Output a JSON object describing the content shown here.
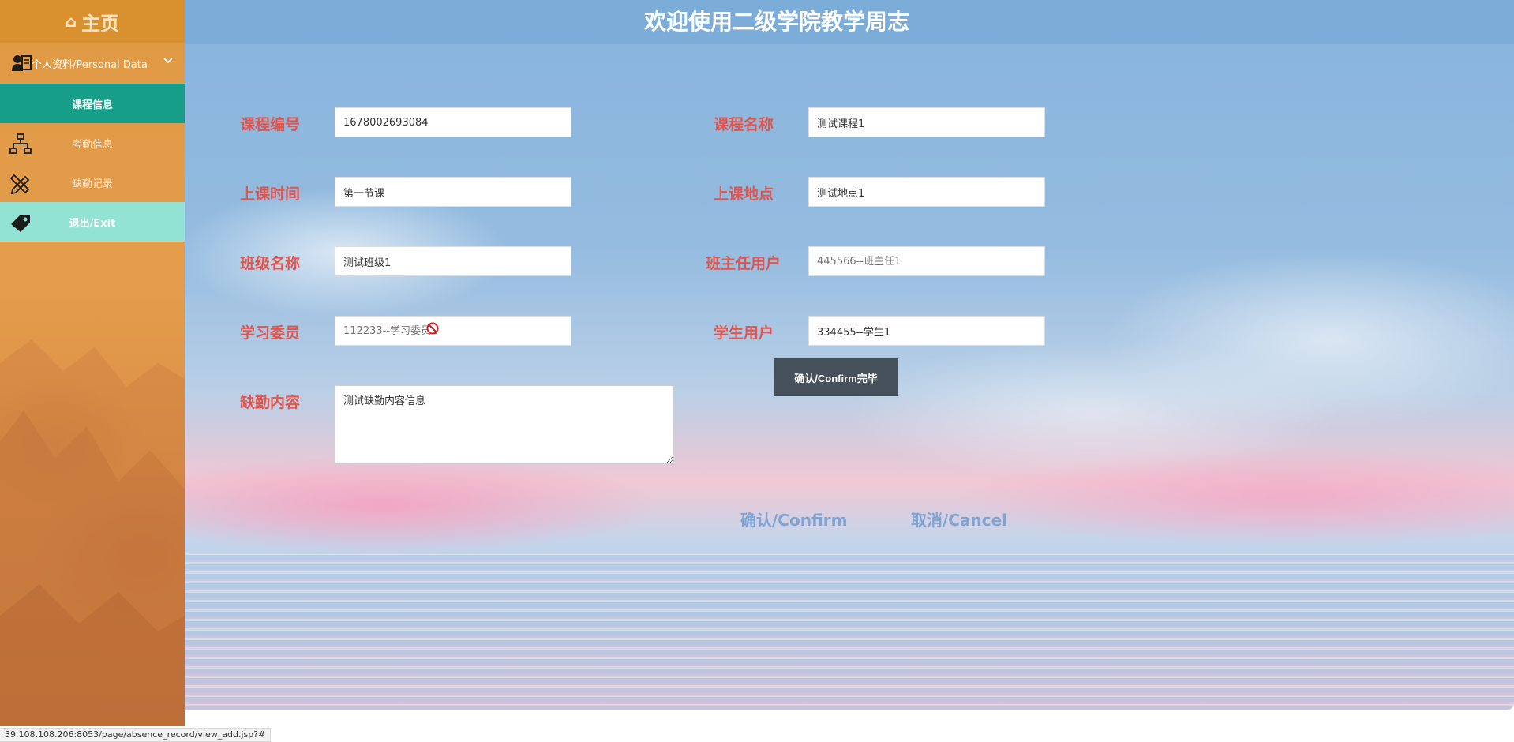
{
  "sidebar": {
    "home_label": "主页",
    "personal_label": "个人资料/Personal Data",
    "items": [
      {
        "label": "课程信息",
        "state": "active"
      },
      {
        "label": "考勤信息",
        "state": "normal"
      },
      {
        "label": "缺勤记录",
        "state": "normal"
      },
      {
        "label": "退出/Exit",
        "state": "exit"
      }
    ]
  },
  "header": {
    "title": "欢迎使用二级学院教学周志"
  },
  "form": {
    "course_id": {
      "label": "课程编号",
      "value": "1678002693084"
    },
    "course_name": {
      "label": "课程名称",
      "value": "测试课程1"
    },
    "class_time": {
      "label": "上课时间",
      "value": "第一节课"
    },
    "class_place": {
      "label": "上课地点",
      "value": "测试地点1"
    },
    "class_name": {
      "label": "班级名称",
      "value": "测试班级1"
    },
    "teacher_user": {
      "label": "班主任用户",
      "placeholder": "445566--班主任1"
    },
    "study_rep": {
      "label": "学习委员",
      "placeholder": "112233--学习委员1"
    },
    "student_user": {
      "label": "学生用户",
      "value": "334455--学生1"
    },
    "absence": {
      "label": "缺勤内容",
      "value": "测试缺勤内容信息"
    }
  },
  "buttons": {
    "confirm_done": "确认/Confirm完毕",
    "confirm": "确认/Confirm",
    "cancel": "取消/Cancel"
  },
  "status_bar": {
    "url": "39.108.108.206:8053/page/absence_record/view_add.jsp?#"
  }
}
